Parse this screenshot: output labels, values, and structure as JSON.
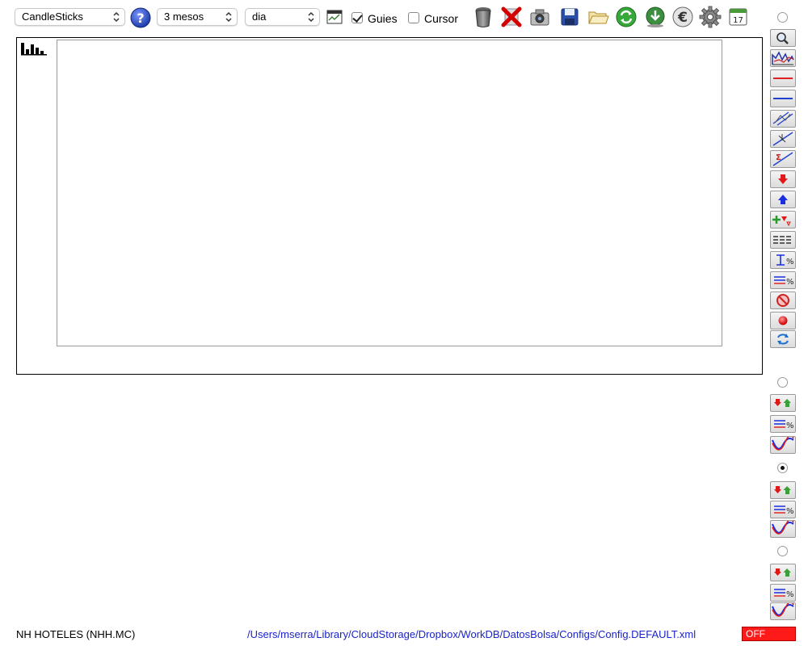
{
  "toolbar": {
    "chart_type": "CandleSticks",
    "period": "3 mesos",
    "interval": "dia",
    "guides_label": "Guies",
    "guides_checked": true,
    "cursor_label": "Cursor",
    "cursor_checked": false,
    "icons": [
      "help-icon",
      "calendar-chart-icon",
      "trash-icon",
      "delete-x-icon",
      "camera-icon",
      "save-icon",
      "folder-icon",
      "refresh-icon",
      "download-icon",
      "euro-icon",
      "settings-icon",
      "calendar-17-icon"
    ],
    "calendar_day": "17"
  },
  "side_tools": {
    "top_radio_selected": false,
    "group1_radio_selected": false,
    "group2_radio_selected": true,
    "group3_radio_selected": false
  },
  "status": {
    "company": "NH HOTELES (NHH.MC)",
    "config_path": "/Users/mserra/Library/CloudStorage/Dropbox/WorkDB/DatosBolsa/Configs/Config.DEFAULT.xml",
    "off_label": "OFF"
  },
  "colors": {
    "link": "#1a24c8",
    "off_bg": "#ff1a1a",
    "help_blue": "#2b49c4"
  }
}
